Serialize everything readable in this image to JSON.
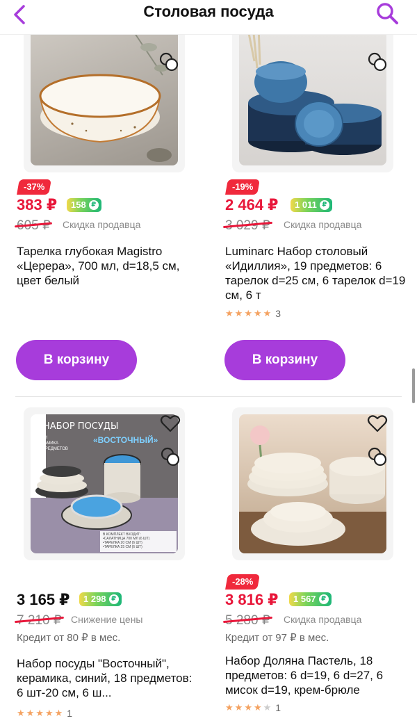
{
  "header": {
    "title": "Столовая посуда",
    "back_icon": "chevron-left-icon",
    "search_icon": "search-icon"
  },
  "colors": {
    "accent": "#a73cdb",
    "price_red": "#e8173a",
    "discount_bg": "#f0293c",
    "star": "#f4a261"
  },
  "products": [
    {
      "discount": "-37%",
      "price": "383 ₽",
      "bonus": "158",
      "old_price": "605 ₽",
      "old_note": "Скидка продавца",
      "name": "Тарелка глубокая Magistro «Церера», 700 мл, d=18,5 см, цвет белый",
      "cart_label": "В корзину"
    },
    {
      "discount": "-19%",
      "price": "2 464 ₽",
      "bonus": "1 011",
      "old_price": "3 029 ₽",
      "old_note": "Скидка продавца",
      "name": "Luminarc Набор столовый «Идиллия», 19 предметов: 6 тарелок d=25 см, 6 тарелок d=19 см, 6 т",
      "rating": 5,
      "reviews": "3",
      "cart_label": "В корзину"
    },
    {
      "price": "3 165 ₽",
      "bonus": "1 298",
      "old_price": "7 210 ₽",
      "old_note": "Снижение цены",
      "credit": "Кредит от 80 ₽ в мес.",
      "name": "Набор посуды \"Восточный\", керамика, синий, 18 предметов: 6 шт-20 см, 6 ш...",
      "rating": 5,
      "reviews": "1",
      "image_text": {
        "title1": "НАБОР ПОСУДЫ",
        "title2": "«ВОСТОЧНЫЙ»",
        "bullets": [
          "•ИРАН",
          "•КЕРАМИКА",
          "•18 ПРЕДМЕТОВ"
        ],
        "spec": [
          "В КОМПЛЕКТ ВХОДИТ:",
          "•САЛАТНИЦА 700 МЛ (6 ШТ)",
          "•ТАРЕЛКА 20 СМ (6 ШТ)",
          "•ТАРЕЛКА 25 СМ (6 ШТ)"
        ]
      }
    },
    {
      "discount": "-28%",
      "price": "3 816 ₽",
      "bonus": "1 567",
      "old_price": "5 280 ₽",
      "old_note": "Скидка продавца",
      "credit": "Кредит от 97 ₽ в мес.",
      "name": "Набор Доляна Пастель, 18 предметов: 6 d=19, 6 d=27, 6 мисок d=19, крем-брюле",
      "rating": 4,
      "reviews": "1"
    }
  ]
}
